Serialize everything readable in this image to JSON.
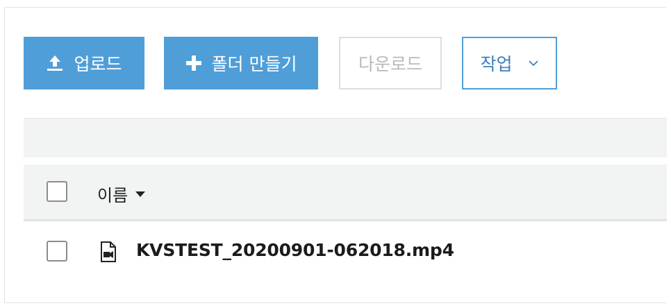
{
  "toolbar": {
    "upload_label": "업로드",
    "new_folder_label": "폴더 만들기",
    "download_label": "다운로드",
    "actions_label": "작업"
  },
  "table": {
    "columns": [
      {
        "label": "이름",
        "sort": "descending"
      }
    ],
    "rows": [
      {
        "name": "KVSTEST_20200901-062018.mp4",
        "icon": "video-file-icon",
        "checked": false
      }
    ]
  },
  "icons": {
    "upload": "upload-icon",
    "new_folder": "plus-icon",
    "actions_dropdown": "chevron-down-icon",
    "sort": "sort-down-icon",
    "file": "video-file-icon"
  },
  "colors": {
    "primary": "#4f9ed8",
    "action_text": "#3a7fc0",
    "disabled_text": "#b9b9b9",
    "header_bg": "#f2f3f3"
  }
}
